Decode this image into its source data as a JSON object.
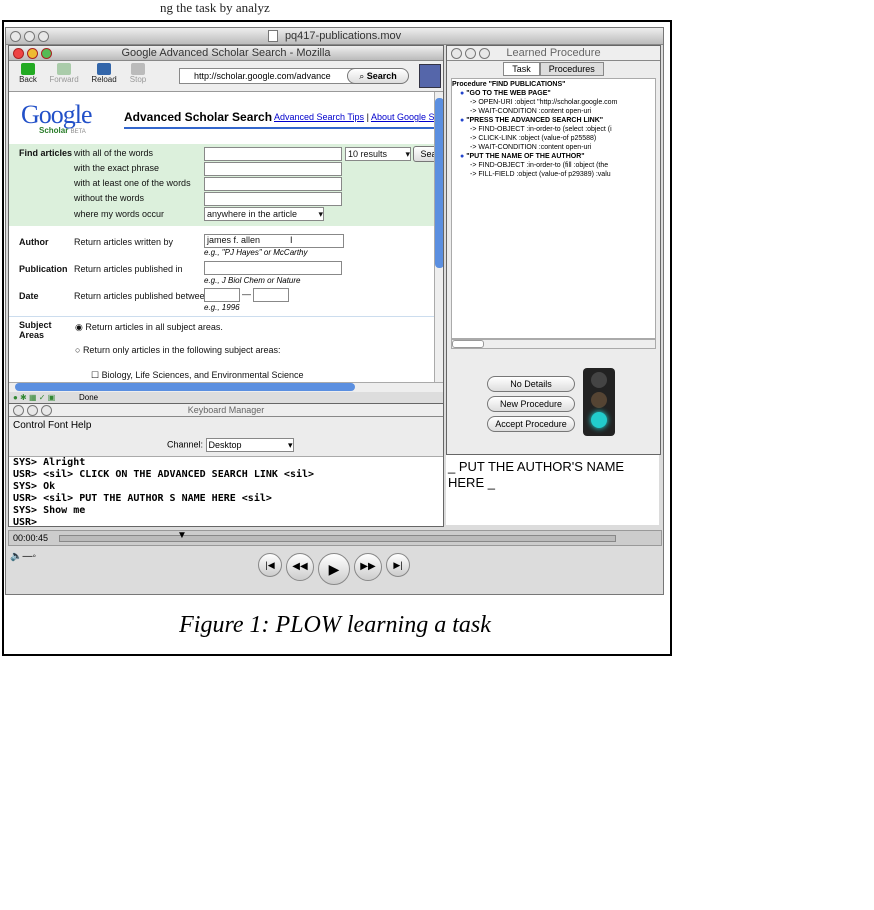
{
  "top_text": "ng the task by analyz",
  "movie": {
    "title": "pq417-publications.mov",
    "time": "00:00:45"
  },
  "browser": {
    "title": "Google Advanced Scholar Search - Mozilla",
    "toolbar": {
      "back": "Back",
      "forward": "Forward",
      "reload": "Reload",
      "stop": "Stop"
    },
    "url": "http://scholar.google.com/advance",
    "search_btn": "Search",
    "logo": "Google",
    "logo_sub": "Scholar",
    "logo_beta": "BETA",
    "page_heading": "Advanced Scholar Search",
    "tips_link": "Advanced Search Tips",
    "sep": "|",
    "about_link": "About Google Sc",
    "find_label": "Find articles",
    "find_rows": [
      "with all of the words",
      "with the exact phrase",
      "with at least one of the words",
      "without the words",
      "where my words occur"
    ],
    "results_select": "10 results",
    "search_small": "Sear",
    "occur_select": "anywhere in the article",
    "author_label": "Author",
    "author_desc": "Return articles written by",
    "author_value": "james f. allen",
    "author_hint": "e.g., \"PJ Hayes\" or McCarthy",
    "pub_label": "Publication",
    "pub_desc": "Return articles published in",
    "pub_hint": "e.g., J Biol Chem or Nature",
    "date_label": "Date",
    "date_desc": "Return articles published between",
    "date_dash": "—",
    "date_hint": "e.g., 1996",
    "subject_label": "Subject Areas",
    "subject_all": "Return articles in all subject areas.",
    "subject_only": "Return only articles in the following subject areas:",
    "subject_bio": "Biology, Life Sciences, and Environmental Science",
    "status": "Done"
  },
  "learned": {
    "title": "Learned Procedure",
    "tabs": [
      "Task",
      "Procedures"
    ],
    "lines": [
      "Procedure \"FIND PUBLICATIONS\"",
      "\"GO TO THE WEB PAGE\"",
      "-> OPEN-URI :object \"http://scholar.google.com",
      "-> WAIT-CONDITION :content open-uri",
      "\"PRESS THE ADVANCED SEARCH LINK\"",
      "-> FIND-OBJECT :in-order-to (select :object (i",
      "-> CLICK-LINK :object (value-of p25588)",
      "-> WAIT-CONDITION :content open-uri",
      "\"PUT THE NAME OF THE AUTHOR\"",
      "-> FIND-OBJECT :in-order-to (fill :object (the",
      "-> FILL-FIELD :object (value-of p29389) :valu"
    ],
    "buttons": [
      "No Details",
      "New Procedure",
      "Accept Procedure"
    ]
  },
  "keyboard": {
    "title": "Keyboard Manager",
    "menu": [
      "Control",
      "Font",
      "Help"
    ],
    "channel_label": "Channel:",
    "channel_value": "Desktop",
    "log": [
      "SYS> Alright",
      "USR> <sil> CLICK ON THE ADVANCED SEARCH LINK <sil>",
      "SYS> Ok",
      "USR> <sil> PUT THE AUTHOR S NAME HERE <sil>",
      "SYS> Show me",
      "USR>"
    ]
  },
  "speech": "_ PUT THE AUTHOR'S NAME HERE _",
  "caption": "Figure 1: PLOW learning a task"
}
